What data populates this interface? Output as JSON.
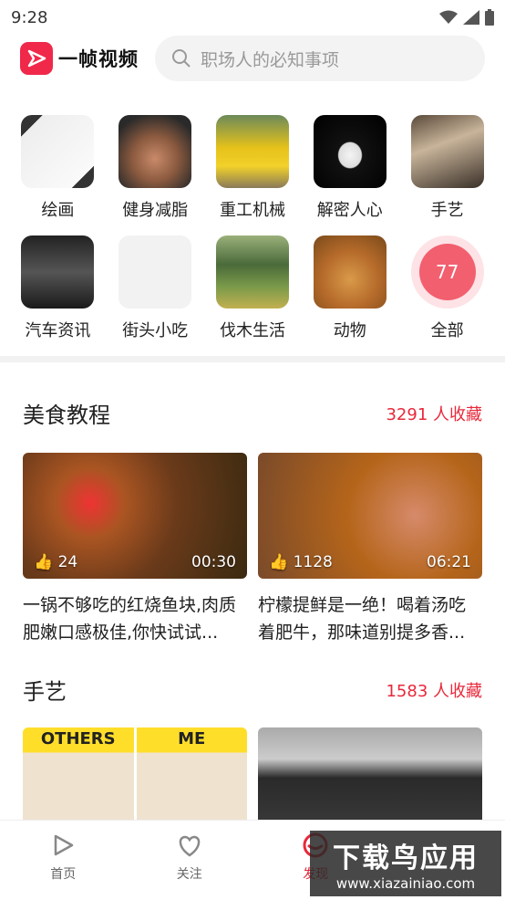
{
  "status": {
    "time": "9:28"
  },
  "header": {
    "app_name": "一帧视频",
    "search_placeholder": "职场人的必知事项"
  },
  "categories": [
    {
      "label": "绘画",
      "icon": "painting-thumb"
    },
    {
      "label": "健身减脂",
      "icon": "fitness-thumb"
    },
    {
      "label": "重工机械",
      "icon": "machinery-thumb"
    },
    {
      "label": "解密人心",
      "icon": "mask-thumb"
    },
    {
      "label": "手艺",
      "icon": "craft-thumb"
    },
    {
      "label": "汽车资讯",
      "icon": "car-thumb"
    },
    {
      "label": "街头小吃",
      "icon": "blank-thumb"
    },
    {
      "label": "伐木生活",
      "icon": "logging-thumb"
    },
    {
      "label": "动物",
      "icon": "lion-thumb"
    },
    {
      "label": "全部",
      "count": "77"
    }
  ],
  "sections": [
    {
      "title": "美食教程",
      "count": "3291 人收藏",
      "cards": [
        {
          "likes": "24",
          "duration": "00:30",
          "title": "一锅不够吃的红烧鱼块,肉质肥嫩口感极佳,你快试试..."
        },
        {
          "likes": "1128",
          "duration": "06:21",
          "title": "柠檬提鲜是一绝！喝着汤吃着肥牛，那味道别提多香..."
        }
      ]
    },
    {
      "title": "手艺",
      "count": "1583 人收藏",
      "cards": [
        {
          "overlay_left": "OTHERS",
          "overlay_right": "ME"
        },
        {}
      ]
    }
  ],
  "tabs": [
    {
      "label": "首页"
    },
    {
      "label": "关注"
    },
    {
      "label": "发现"
    }
  ],
  "watermark": {
    "main": "下载鸟应用",
    "sub": "www.xiazainiao.com"
  },
  "colors": {
    "accent": "#e8283a",
    "brand": "#f0284a"
  }
}
